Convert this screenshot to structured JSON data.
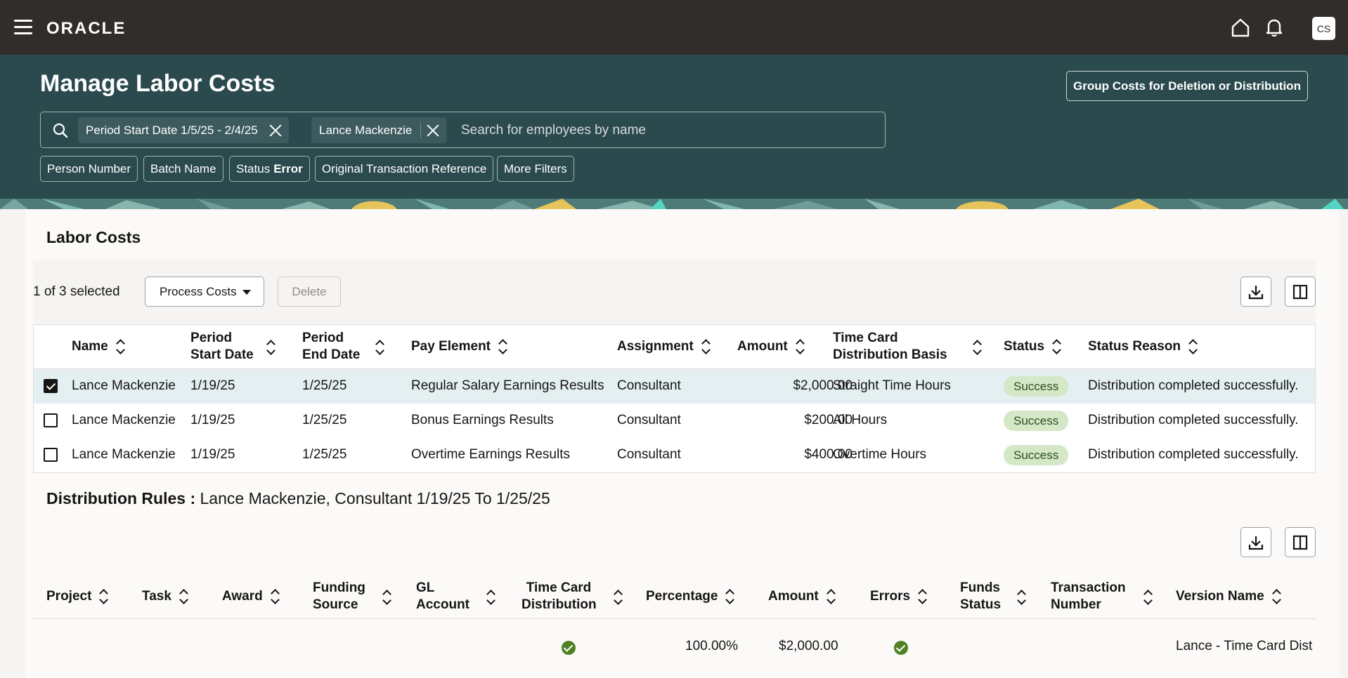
{
  "topbar": {
    "brand": "ORACLE",
    "avatar": "CS"
  },
  "header": {
    "title": "Manage Labor Costs",
    "group_button": "Group Costs for Deletion or Distribution",
    "search": {
      "chips": [
        {
          "label": "Period Start Date 1/5/25 - 2/4/25"
        },
        {
          "label": "Lance Mackenzie"
        }
      ],
      "placeholder": "Search for employees by name"
    },
    "filters": [
      {
        "label": "Person Number",
        "value": ""
      },
      {
        "label": "Batch Name",
        "value": ""
      },
      {
        "label": "Status",
        "value": "Error"
      },
      {
        "label": "Original Transaction Reference",
        "value": ""
      },
      {
        "label": "More Filters",
        "value": ""
      }
    ]
  },
  "labor_costs": {
    "title": "Labor Costs",
    "selected_text": "1 of 3 selected",
    "process_button": "Process Costs",
    "delete_button": "Delete",
    "columns": [
      "Name",
      "Period Start Date",
      "Period End Date",
      "Pay Element",
      "Assignment",
      "Amount",
      "Time Card Distribution Basis",
      "Status",
      "Status Reason"
    ],
    "rows": [
      {
        "checked": true,
        "name": "Lance Mackenzie",
        "start": "1/19/25",
        "end": "1/25/25",
        "pay_element": "Regular Salary Earnings Results",
        "assignment": "Consultant",
        "amount": "$2,000.00",
        "basis": "Straight Time Hours",
        "status": "Success",
        "reason": "Distribution completed successfully."
      },
      {
        "checked": false,
        "name": "Lance Mackenzie",
        "start": "1/19/25",
        "end": "1/25/25",
        "pay_element": "Bonus Earnings Results",
        "assignment": "Consultant",
        "amount": "$200.00",
        "basis": "All Hours",
        "status": "Success",
        "reason": "Distribution completed successfully."
      },
      {
        "checked": false,
        "name": "Lance Mackenzie",
        "start": "1/19/25",
        "end": "1/25/25",
        "pay_element": "Overtime Earnings Results",
        "assignment": "Consultant",
        "amount": "$400.00",
        "basis": "Overtime Hours",
        "status": "Success",
        "reason": "Distribution completed successfully."
      }
    ]
  },
  "distribution": {
    "title_bold": "Distribution Rules :",
    "title_rest": " Lance Mackenzie, Consultant 1/19/25 To 1/25/25",
    "columns": [
      "Project",
      "Task",
      "Award",
      "Funding Source",
      "GL Account",
      "Time Card Distribution",
      "Percentage",
      "Amount",
      "Errors",
      "Funds Status",
      "Transaction Number",
      "Version Name"
    ],
    "rows": [
      {
        "time_card_distribution": "ok-icon",
        "percentage": "100.00%",
        "amount": "$2,000.00",
        "errors": "ok-icon",
        "version_name": "Lance - Time Card Dist"
      }
    ]
  }
}
